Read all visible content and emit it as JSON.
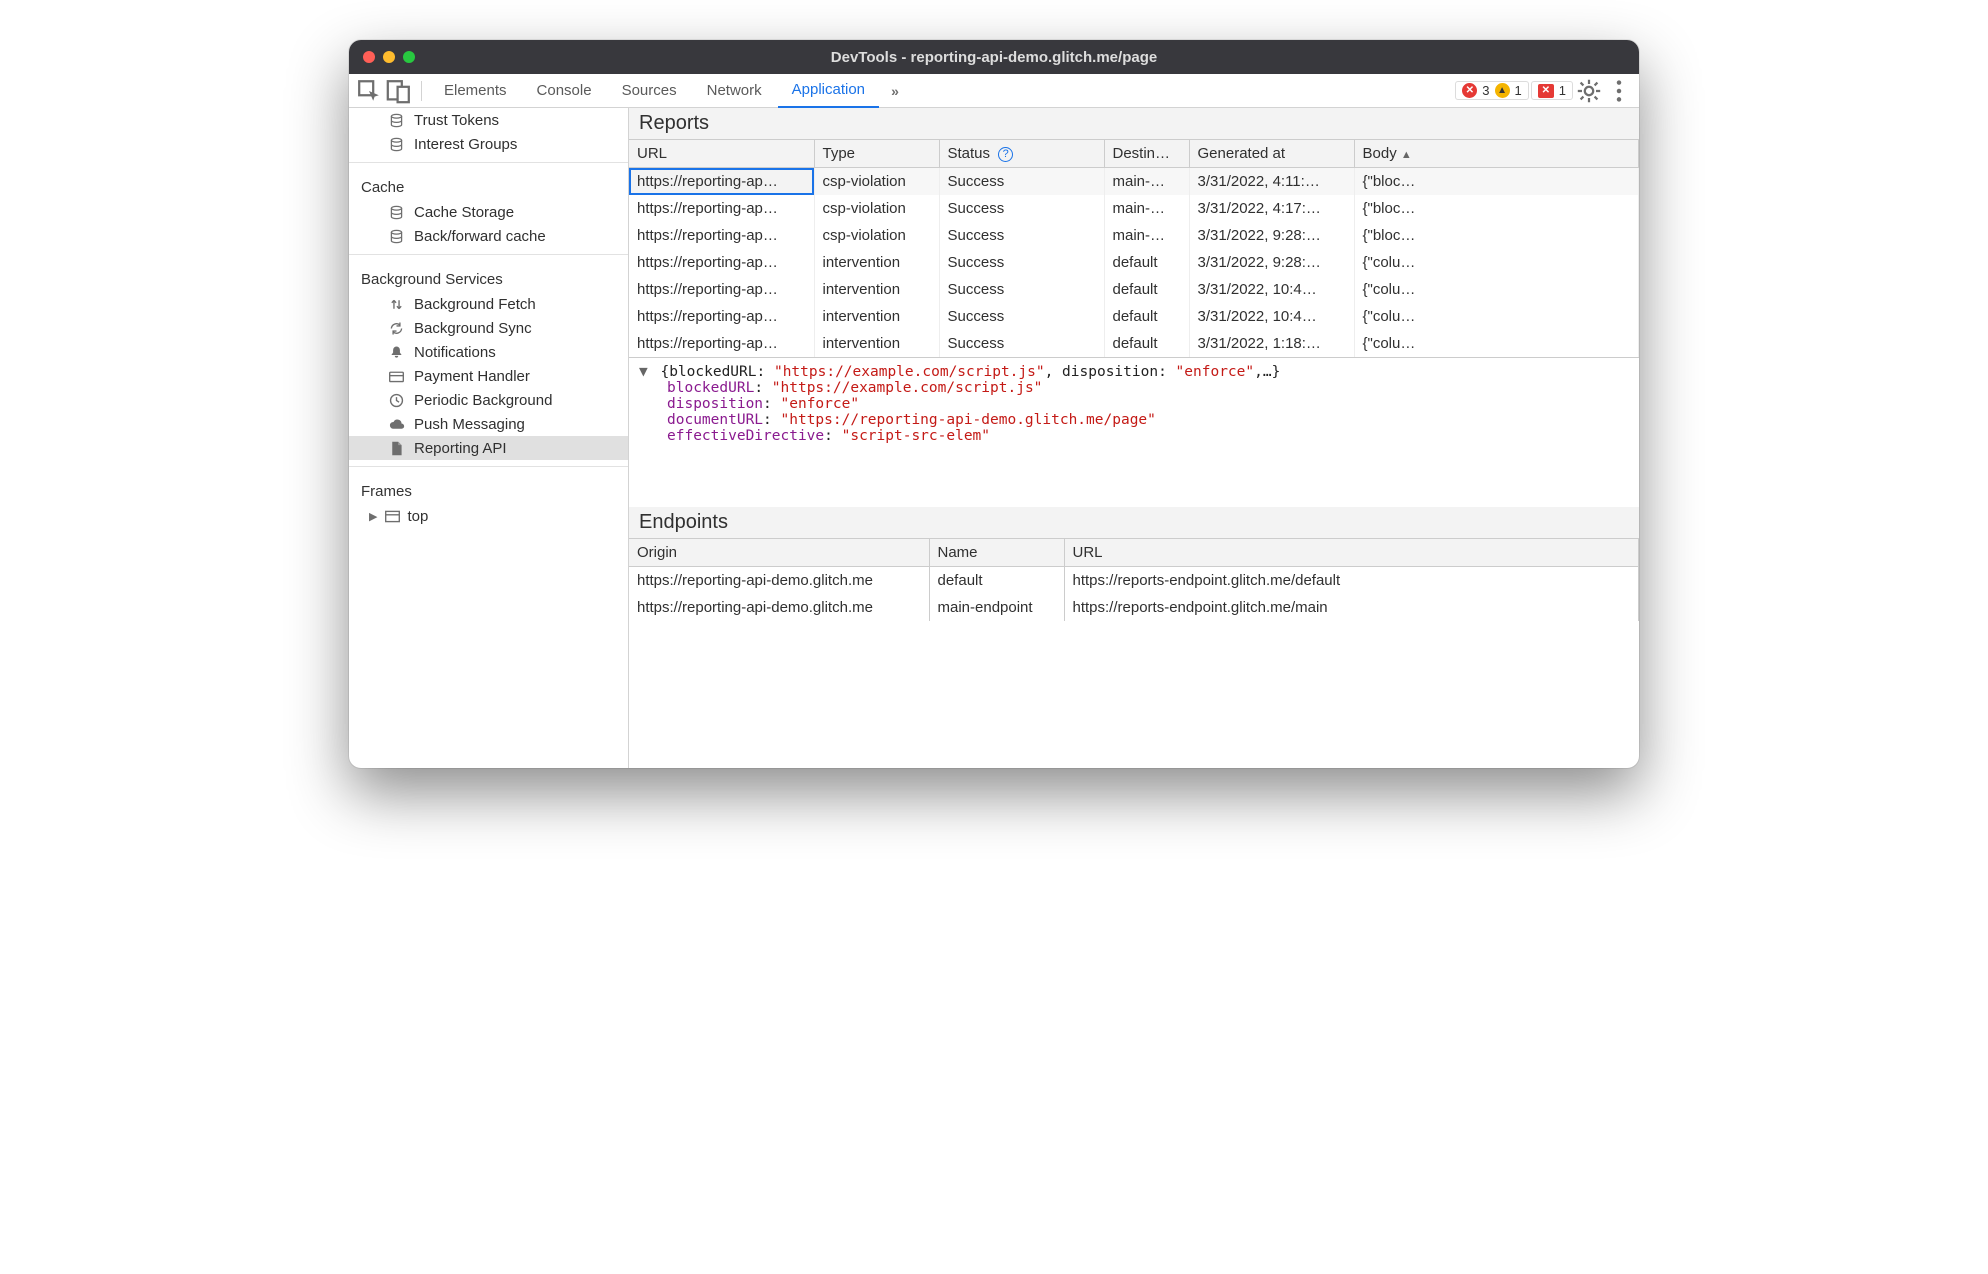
{
  "window": {
    "title": "DevTools - reporting-api-demo.glitch.me/page"
  },
  "toolbar": {
    "errors_count": "3",
    "warnings_count": "1",
    "issues_count": "1"
  },
  "tabs": [
    "Elements",
    "Console",
    "Sources",
    "Network",
    "Application"
  ],
  "active_tab": "Application",
  "sidebar": {
    "pre_items": [
      {
        "label": "Trust Tokens",
        "icon": "db"
      },
      {
        "label": "Interest Groups",
        "icon": "db"
      }
    ],
    "groups": [
      {
        "label": "Cache",
        "items": [
          {
            "label": "Cache Storage",
            "icon": "db"
          },
          {
            "label": "Back/forward cache",
            "icon": "db"
          }
        ]
      },
      {
        "label": "Background Services",
        "items": [
          {
            "label": "Background Fetch",
            "icon": "updown"
          },
          {
            "label": "Background Sync",
            "icon": "sync"
          },
          {
            "label": "Notifications",
            "icon": "bell"
          },
          {
            "label": "Payment Handler",
            "icon": "card"
          },
          {
            "label": "Periodic Background",
            "icon": "clock"
          },
          {
            "label": "Push Messaging",
            "icon": "cloud"
          },
          {
            "label": "Reporting API",
            "icon": "doc",
            "selected": true
          }
        ]
      }
    ],
    "frames_label": "Frames",
    "frame_top_label": "top"
  },
  "reports": {
    "title": "Reports",
    "columns": [
      "URL",
      "Type",
      "Status",
      "Destin…",
      "Generated at",
      "Body"
    ],
    "rows": [
      {
        "url": "https://reporting-ap…",
        "type": "csp-violation",
        "status": "Success",
        "dest": "main-…",
        "time": "3/31/2022, 4:11:…",
        "body": "{\"bloc…",
        "sel": true
      },
      {
        "url": "https://reporting-ap…",
        "type": "csp-violation",
        "status": "Success",
        "dest": "main-…",
        "time": "3/31/2022, 4:17:…",
        "body": "{\"bloc…"
      },
      {
        "url": "https://reporting-ap…",
        "type": "csp-violation",
        "status": "Success",
        "dest": "main-…",
        "time": "3/31/2022, 9:28:…",
        "body": "{\"bloc…"
      },
      {
        "url": "https://reporting-ap…",
        "type": "intervention",
        "status": "Success",
        "dest": "default",
        "time": "3/31/2022, 9:28:…",
        "body": "{\"colu…"
      },
      {
        "url": "https://reporting-ap…",
        "type": "intervention",
        "status": "Success",
        "dest": "default",
        "time": "3/31/2022, 10:4…",
        "body": "{\"colu…"
      },
      {
        "url": "https://reporting-ap…",
        "type": "intervention",
        "status": "Success",
        "dest": "default",
        "time": "3/31/2022, 10:4…",
        "body": "{\"colu…"
      },
      {
        "url": "https://reporting-ap…",
        "type": "intervention",
        "status": "Success",
        "dest": "default",
        "time": "3/31/2022, 1:18:…",
        "body": "{\"colu…"
      }
    ]
  },
  "detail": {
    "summary_pre": "{blockedURL: ",
    "summary_str1": "\"https://example.com/script.js\"",
    "summary_mid": ", disposition: ",
    "summary_str2": "\"enforce\"",
    "summary_post": ",…}",
    "props": [
      {
        "key": "blockedURL",
        "val": "\"https://example.com/script.js\""
      },
      {
        "key": "disposition",
        "val": "\"enforce\""
      },
      {
        "key": "documentURL",
        "val": "\"https://reporting-api-demo.glitch.me/page\""
      },
      {
        "key": "effectiveDirective",
        "val": "\"script-src-elem\""
      }
    ]
  },
  "endpoints": {
    "title": "Endpoints",
    "columns": [
      "Origin",
      "Name",
      "URL"
    ],
    "rows": [
      {
        "origin": "https://reporting-api-demo.glitch.me",
        "name": "default",
        "url": "https://reports-endpoint.glitch.me/default"
      },
      {
        "origin": "https://reporting-api-demo.glitch.me",
        "name": "main-endpoint",
        "url": "https://reports-endpoint.glitch.me/main"
      }
    ]
  }
}
